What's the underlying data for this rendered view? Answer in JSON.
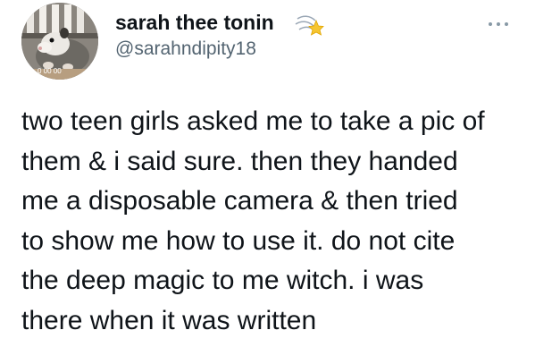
{
  "tweet": {
    "display_name": "sarah thee tonin",
    "handle": "@sarahndipity18",
    "badge_icon": "shooting-star-emoji",
    "menu_icon": "more-options-icon",
    "avatar": {
      "description_icon": "possum-avatar",
      "timestamp_overlay": "0 00 00"
    },
    "lines": [
      "two teen girls asked me to take a pic of",
      "them & i said sure. then they handed",
      "me a disposable camera & then tried",
      "to show me how to use it. do not cite",
      "the deep magic to me witch. i was",
      "there when it was written"
    ]
  }
}
